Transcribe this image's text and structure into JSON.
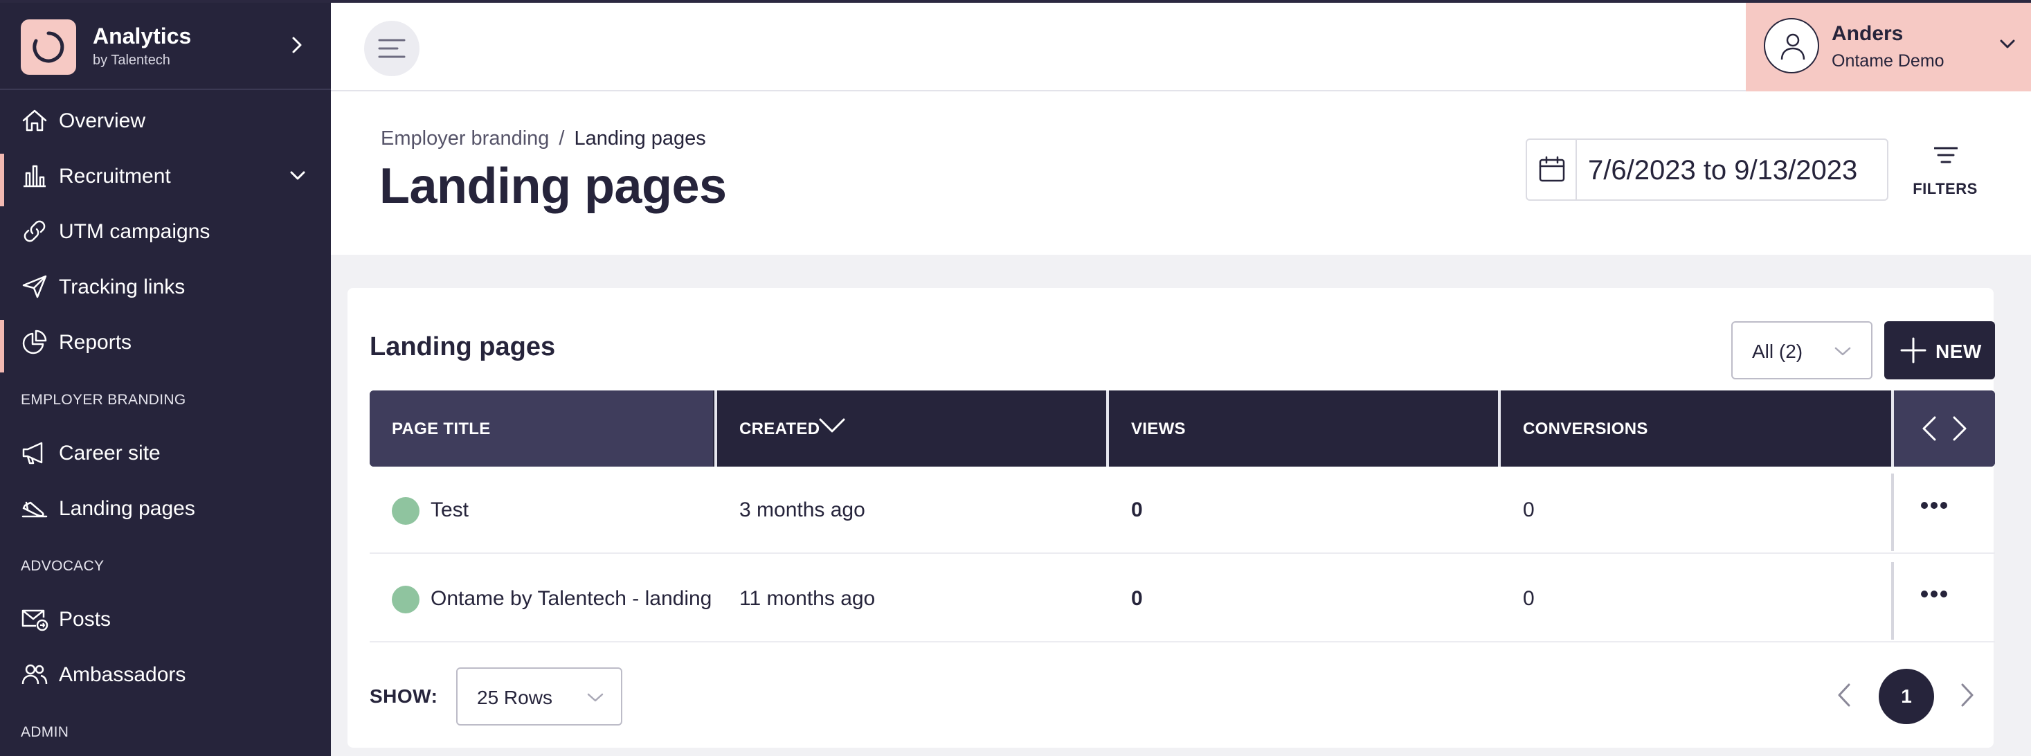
{
  "app": {
    "name": "Analytics",
    "subtitle": "by Talentech"
  },
  "sidebar": {
    "items": [
      {
        "label": "Overview",
        "icon": "home-icon"
      },
      {
        "label": "Recruitment",
        "icon": "bar-chart-icon"
      },
      {
        "label": "UTM campaigns",
        "icon": "link-icon"
      },
      {
        "label": "Tracking links",
        "icon": "send-icon"
      },
      {
        "label": "Reports",
        "icon": "pie-chart-icon"
      }
    ],
    "sections": {
      "employer_branding": "EMPLOYER BRANDING",
      "advocacy": "ADVOCACY",
      "admin": "ADMIN"
    },
    "employer_branding_items": [
      {
        "label": "Career site",
        "icon": "megaphone-icon"
      },
      {
        "label": "Landing pages",
        "icon": "landing-icon"
      }
    ],
    "advocacy_items": [
      {
        "label": "Posts",
        "icon": "mail-send-icon"
      },
      {
        "label": "Ambassadors",
        "icon": "users-icon"
      }
    ]
  },
  "user": {
    "name": "Anders",
    "org": "Ontame Demo"
  },
  "header": {
    "breadcrumb_parent": "Employer branding",
    "breadcrumb_separator": "/",
    "breadcrumb_current": "Landing pages",
    "title": "Landing pages",
    "date_range": "7/6/2023 to 9/13/2023",
    "filters_label": "FILTERS"
  },
  "card": {
    "title": "Landing pages",
    "filter_value": "All (2)",
    "new_label": "NEW",
    "columns": {
      "page_title": "PAGE TITLE",
      "created": "CREATED",
      "views": "VIEWS",
      "conversions": "CONVERSIONS"
    },
    "rows": [
      {
        "title": "Test",
        "created": "3 months ago",
        "views": "0",
        "conversions": "0"
      },
      {
        "title": "Ontame by Talentech - landing page",
        "created": "11 months ago",
        "views": "0",
        "conversions": "0"
      }
    ],
    "show_label": "SHOW:",
    "rows_per_page": "25 Rows",
    "current_page": "1"
  },
  "colors": {
    "sidebar_bg": "#26243b",
    "accent_pink": "#f6c9c4",
    "status_green": "#8fc49f"
  }
}
